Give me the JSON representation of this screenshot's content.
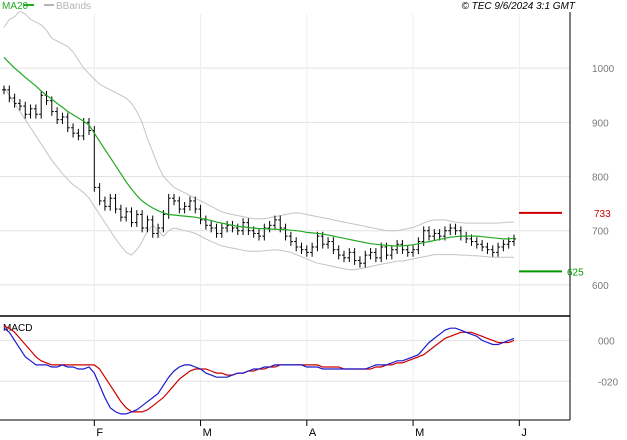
{
  "header": {
    "legend": [
      {
        "name": "MA20",
        "color": "#22aa22"
      },
      {
        "name": "BBands",
        "color": "#b5b5b5"
      }
    ],
    "copyright": "© TEC 9/6/2024 3:1 GMT"
  },
  "chart_data": [
    {
      "type": "line",
      "panel": "price",
      "y_ticks": [
        600,
        700,
        800,
        900,
        1000
      ],
      "y_tick_labels": [
        "600",
        "700",
        "800",
        "900",
        "1000"
      ],
      "ylim": [
        550,
        1100
      ],
      "x_ticks": [
        {
          "label": "F",
          "index": 17
        },
        {
          "label": "M",
          "index": 37
        },
        {
          "label": "A",
          "index": 57
        },
        {
          "label": "M",
          "index": 77
        },
        {
          "label": "J",
          "index": 97
        }
      ],
      "grid": true,
      "close": [
        960,
        945,
        935,
        930,
        915,
        925,
        915,
        950,
        940,
        920,
        905,
        910,
        890,
        880,
        875,
        900,
        885,
        780,
        755,
        745,
        760,
        740,
        725,
        735,
        715,
        730,
        705,
        720,
        695,
        705,
        730,
        760,
        755,
        740,
        745,
        755,
        740,
        720,
        710,
        705,
        695,
        705,
        710,
        705,
        700,
        715,
        700,
        695,
        690,
        705,
        710,
        720,
        705,
        690,
        680,
        670,
        665,
        660,
        670,
        690,
        675,
        680,
        665,
        655,
        650,
        660,
        645,
        640,
        655,
        660,
        650,
        670,
        655,
        665,
        675,
        665,
        660,
        665,
        680,
        700,
        690,
        695,
        690,
        700,
        705,
        700,
        690,
        685,
        680,
        675,
        670,
        665,
        660,
        670,
        675,
        680,
        685
      ],
      "ma20": [
        1020,
        1010,
        1000,
        992,
        983,
        975,
        967,
        958,
        950,
        943,
        935,
        928,
        920,
        914,
        908,
        902,
        895,
        880,
        865,
        850,
        835,
        820,
        805,
        790,
        777,
        765,
        755,
        748,
        742,
        737,
        733,
        730,
        729,
        728,
        727,
        726,
        725,
        723,
        721,
        719,
        716,
        714,
        712,
        710,
        708,
        707,
        706,
        705,
        704,
        704,
        703,
        703,
        702,
        702,
        701,
        700,
        699,
        697,
        696,
        695,
        694,
        692,
        690,
        688,
        686,
        684,
        682,
        680,
        678,
        676,
        675,
        674,
        673,
        672,
        672,
        672,
        673,
        674,
        676,
        678,
        680,
        682,
        684,
        686,
        688,
        689,
        690,
        690,
        690,
        690,
        689,
        688,
        687,
        686,
        685,
        685,
        686
      ],
      "bb_upper": [
        1075,
        1090,
        1095,
        1105,
        1100,
        1090,
        1085,
        1080,
        1070,
        1055,
        1050,
        1045,
        1040,
        1030,
        1015,
        1000,
        990,
        980,
        970,
        965,
        960,
        955,
        950,
        945,
        935,
        920,
        900,
        870,
        845,
        820,
        800,
        790,
        780,
        775,
        770,
        765,
        760,
        755,
        750,
        745,
        740,
        735,
        732,
        730,
        728,
        726,
        724,
        722,
        722,
        722,
        724,
        726,
        728,
        730,
        732,
        733,
        732,
        730,
        728,
        726,
        724,
        722,
        720,
        718,
        716,
        714,
        712,
        710,
        708,
        706,
        704,
        702,
        700,
        700,
        700,
        702,
        704,
        706,
        710,
        714,
        718,
        720,
        720,
        720,
        718,
        716,
        715,
        714,
        714,
        714,
        714,
        714,
        714,
        714,
        715,
        716,
        716
      ],
      "bb_lower": [
        965,
        950,
        935,
        920,
        905,
        890,
        875,
        860,
        845,
        830,
        818,
        805,
        795,
        785,
        778,
        770,
        760,
        745,
        730,
        715,
        700,
        685,
        672,
        660,
        655,
        665,
        680,
        700,
        710,
        700,
        690,
        700,
        705,
        703,
        700,
        698,
        695,
        690,
        685,
        680,
        676,
        672,
        670,
        668,
        666,
        664,
        662,
        662,
        662,
        663,
        664,
        665,
        664,
        662,
        660,
        656,
        652,
        648,
        644,
        640,
        638,
        636,
        634,
        632,
        630,
        628,
        628,
        630,
        632,
        634,
        636,
        638,
        640,
        642,
        644,
        644,
        646,
        648,
        650,
        652,
        654,
        656,
        656,
        656,
        656,
        656,
        655,
        655,
        654,
        654,
        653,
        652,
        651,
        651,
        651,
        651,
        651
      ],
      "target_levels": [
        {
          "value": 733,
          "label": "733",
          "color": "#cc0000"
        },
        {
          "value": 625,
          "label": "625",
          "color": "#009900"
        }
      ]
    },
    {
      "type": "line",
      "panel": "macd",
      "title": "MACD",
      "y_ticks": [
        0,
        -20
      ],
      "y_tick_labels": [
        "000",
        "-020"
      ],
      "ylim": [
        -38,
        10
      ],
      "macd": [
        6,
        4,
        0,
        -4,
        -8,
        -10,
        -12,
        -12,
        -12,
        -13,
        -13,
        -12,
        -13,
        -13,
        -14,
        -14,
        -13,
        -16,
        -22,
        -28,
        -33,
        -35,
        -36,
        -36,
        -35,
        -34,
        -32,
        -30,
        -28,
        -26,
        -22,
        -18,
        -15,
        -13,
        -12,
        -12,
        -13,
        -14,
        -16,
        -17,
        -18,
        -18,
        -18,
        -17,
        -16,
        -16,
        -15,
        -14,
        -14,
        -13,
        -13,
        -12,
        -12,
        -12,
        -12,
        -12,
        -12,
        -13,
        -13,
        -13,
        -14,
        -14,
        -14,
        -14,
        -14,
        -14,
        -14,
        -14,
        -14,
        -13,
        -12,
        -12,
        -12,
        -11,
        -10,
        -10,
        -9,
        -8,
        -7,
        -4,
        -1,
        1,
        3,
        5,
        6,
        6,
        5,
        4,
        3,
        2,
        0,
        -1,
        -2,
        -2,
        -1,
        0,
        1
      ],
      "signal": [
        7,
        6,
        4,
        1,
        -2,
        -5,
        -8,
        -10,
        -11,
        -12,
        -12,
        -12,
        -12,
        -12,
        -12,
        -12,
        -12,
        -12,
        -14,
        -18,
        -22,
        -26,
        -30,
        -33,
        -35,
        -35,
        -35,
        -34,
        -32,
        -30,
        -28,
        -25,
        -22,
        -19,
        -17,
        -15,
        -14,
        -14,
        -14,
        -15,
        -16,
        -16,
        -17,
        -17,
        -16,
        -16,
        -15,
        -15,
        -14,
        -14,
        -13,
        -13,
        -12,
        -12,
        -12,
        -12,
        -12,
        -12,
        -12,
        -12,
        -13,
        -13,
        -13,
        -13,
        -14,
        -14,
        -14,
        -14,
        -14,
        -14,
        -13,
        -13,
        -12,
        -12,
        -11,
        -11,
        -10,
        -9,
        -8,
        -7,
        -5,
        -3,
        -1,
        1,
        2,
        3,
        4,
        4,
        4,
        3,
        2,
        1,
        0,
        -1,
        -1,
        -1,
        0
      ]
    }
  ]
}
